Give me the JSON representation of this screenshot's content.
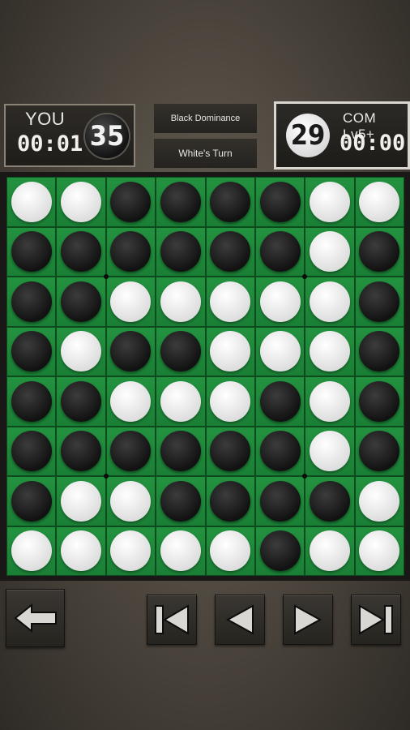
{
  "player": {
    "name": "YOU",
    "time": "00:01",
    "disc_count": "35"
  },
  "computer": {
    "name": "COM Lv5+",
    "time": "00:00",
    "disc_count": "29"
  },
  "status": {
    "dominance": "Black Dominance",
    "turn": "White's Turn"
  },
  "board": {
    "rows": [
      "WWBBBBWW",
      "BBBBBBWB",
      "BBWWWWWB",
      "BWBBWWWB",
      "BBWWWBWB",
      "BBBBBBWB",
      "BWWBBBBW",
      "WWWWWBWW"
    ]
  },
  "controls": {
    "back_icon": "left-arrow-icon",
    "first_icon": "skip-to-start-icon",
    "prev_icon": "step-back-icon",
    "next_icon": "step-forward-icon",
    "last_icon": "skip-to-end-icon"
  }
}
